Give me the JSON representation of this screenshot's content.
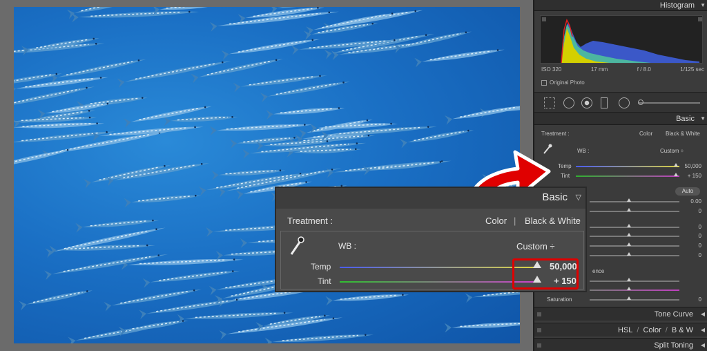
{
  "panel": {
    "histogram_title": "Histogram",
    "meta": {
      "iso": "ISO 320",
      "focal": "17 mm",
      "aperture": "f / 8.0",
      "shutter": "1/125 sec"
    },
    "original_photo": "Original Photo",
    "basic_title": "Basic",
    "treatment_label": "Treatment :",
    "treatment_color": "Color",
    "treatment_bw": "Black & White",
    "wb_label": "WB :",
    "wb_value": "Custom ÷",
    "temp_label": "Temp",
    "temp_value": "50,000",
    "tint_label": "Tint",
    "tint_value": "+ 150",
    "auto_label": "Auto",
    "exposure_value": "0.00",
    "zero_values": [
      "0",
      "0",
      "0",
      "0",
      "0"
    ],
    "partial_label": "ence",
    "saturation_label": "Saturation",
    "saturation_value": "0",
    "tone_curve": "Tone Curve",
    "hsl": "HSL",
    "hsl_color": "Color",
    "hsl_bw": "B & W",
    "hsl_sep": "/",
    "split_toning": "Split Toning"
  },
  "callout": {
    "title": "Basic",
    "treatment_label": "Treatment :",
    "color_label": "Color",
    "separator": "|",
    "bw_label": "Black & White",
    "wb_label": "WB :",
    "wb_value": "Custom ÷",
    "temp_label": "Temp",
    "temp_value": "50,000",
    "tint_label": "Tint",
    "tint_value": "+ 150"
  },
  "colors": {
    "highlight_red": "#e00000",
    "panel_bg": "#3b3b3b",
    "water_blue": "#1a6fc4"
  }
}
